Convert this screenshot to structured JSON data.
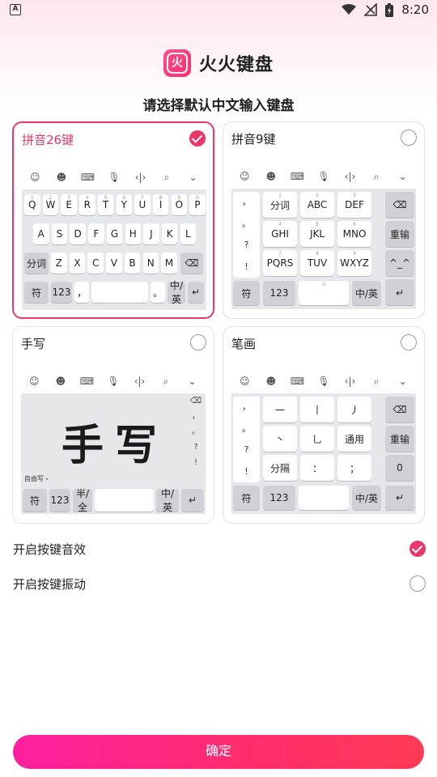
{
  "status_bar": {
    "time": "8:20",
    "left_icon_letter": "A"
  },
  "brand": {
    "logo_glyph": "火",
    "name": "火火键盘"
  },
  "subtitle": "请选择默认中文输入键盘",
  "toolbar_icons": [
    "emoji-pack-icon",
    "smile-icon",
    "keyboard-icon",
    "mic-icon",
    "cursor-icon",
    "search-icon",
    "chevron-down-icon"
  ],
  "toolbar_glyphs": [
    "☺",
    "☻",
    "⌨",
    "🎙",
    "‹|›",
    "⌕",
    "⌄"
  ],
  "cards": [
    {
      "title": "拼音26键",
      "selected": true
    },
    {
      "title": "拼音9键",
      "selected": false
    },
    {
      "title": "手写",
      "selected": false
    },
    {
      "title": "笔画",
      "selected": false
    }
  ],
  "qwerty": {
    "row1": [
      "Q",
      "W",
      "E",
      "R",
      "T",
      "Y",
      "U",
      "I",
      "O",
      "P"
    ],
    "row1_sub": [
      "1",
      "2",
      "3",
      "4",
      "5",
      "6",
      "7",
      "8",
      "9",
      "0"
    ],
    "row2": [
      "A",
      "S",
      "D",
      "F",
      "G",
      "H",
      "J",
      "K",
      "L"
    ],
    "row3": [
      "Z",
      "X",
      "C",
      "V",
      "B",
      "N",
      "M"
    ],
    "fenci": "分词",
    "bottom": {
      "fu": "符",
      "num": "123",
      "comma": "，",
      "period": "。",
      "zhong": "中",
      "ying": "/英",
      "enter": "↵",
      "backspace": "⌫"
    }
  },
  "nine": {
    "left_col": [
      "，",
      "。",
      "?",
      "!"
    ],
    "keys": [
      {
        "main": "分词",
        "sub": "1"
      },
      {
        "main": "ABC",
        "sub": "2"
      },
      {
        "main": "DEF",
        "sub": "3"
      },
      {
        "main": "GHI",
        "sub": "4"
      },
      {
        "main": "JKL",
        "sub": "5"
      },
      {
        "main": "MNO",
        "sub": "6"
      },
      {
        "main": "PQRS",
        "sub": "7"
      },
      {
        "main": "TUV",
        "sub": "8"
      },
      {
        "main": "WXYZ",
        "sub": "9"
      }
    ],
    "right_col": [
      "⌫",
      "重输",
      "^_^",
      "↵"
    ],
    "bottom": {
      "fu": "符",
      "num": "123",
      "space_sub": "0",
      "zhong": "中",
      "ying": "/英"
    }
  },
  "handwrite": {
    "sample": "手写",
    "free_label": "自由写 ›",
    "side_col": [
      "⌫",
      "，",
      "。",
      "?",
      "!"
    ],
    "bottom": {
      "fu": "符",
      "num": "123",
      "ban": "半",
      "quan": "/全",
      "zhong": "中",
      "ying": "/英",
      "enter": "↵"
    }
  },
  "stroke": {
    "left_col": [
      "，",
      "。",
      "?",
      "!"
    ],
    "keys": [
      "一",
      "丨",
      "丿",
      "丶",
      "乚",
      "通用",
      "分隔",
      "：",
      "；"
    ],
    "right_col": [
      "⌫",
      "重输",
      "0"
    ],
    "bottom": {
      "fu": "符",
      "num": "123",
      "zhong": "中",
      "ying": "/英",
      "enter": "↵"
    }
  },
  "toggles": [
    {
      "label": "开启按键音效",
      "on": true
    },
    {
      "label": "开启按键振动",
      "on": false
    }
  ],
  "confirm_label": "确定",
  "colors": {
    "accent": "#e8386b",
    "gradient_start": "#ff1fa0",
    "gradient_end": "#ff3a55"
  }
}
